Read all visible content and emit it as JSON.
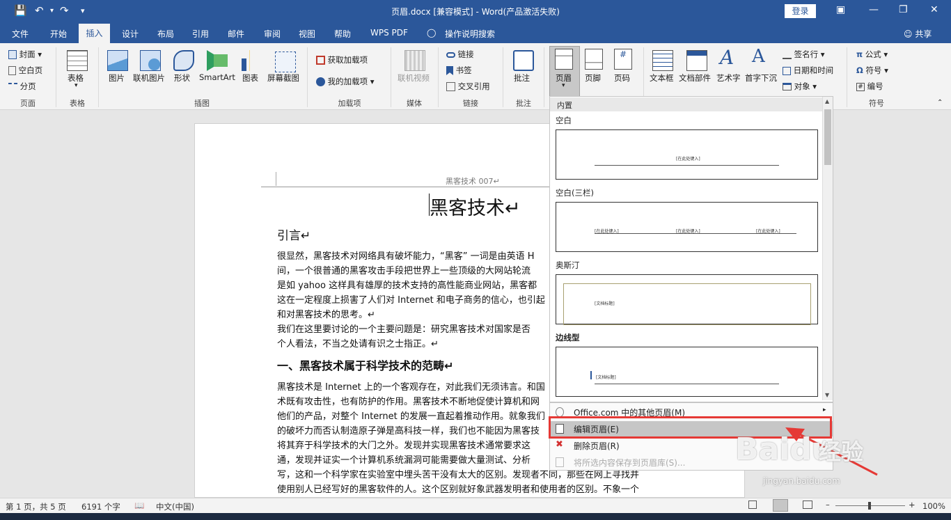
{
  "title_bar": {
    "document_title": "页眉.docx [兼容模式] - Word(产品激活失败)",
    "login": "登录"
  },
  "tabs": [
    "文件",
    "开始",
    "插入",
    "设计",
    "布局",
    "引用",
    "邮件",
    "审阅",
    "视图",
    "帮助",
    "WPS PDF",
    "操作说明搜索"
  ],
  "share": "共享",
  "ribbon": {
    "pages": {
      "items": [
        "封面",
        "空白页",
        "分页"
      ],
      "group": "页面"
    },
    "table": {
      "label": "表格",
      "group": "表格"
    },
    "illustrations": {
      "items": [
        "图片",
        "联机图片",
        "形状",
        "SmartArt",
        "图表",
        "屏幕截图"
      ],
      "group": "插图"
    },
    "addins": {
      "items": [
        "获取加载项",
        "我的加载项"
      ],
      "group": "加载项"
    },
    "media": {
      "label": "联机视频",
      "group": "媒体"
    },
    "links": {
      "items": [
        "链接",
        "书签",
        "交叉引用"
      ],
      "group": "链接"
    },
    "comments": {
      "label": "批注",
      "group": "批注"
    },
    "header_footer": {
      "items": [
        "页眉",
        "页脚",
        "页码"
      ]
    },
    "text": {
      "items": [
        "文本框",
        "文档部件",
        "艺术字",
        "首字下沉"
      ],
      "side": [
        "签名行",
        "日期和时间",
        "对象"
      ]
    },
    "symbols": {
      "items": [
        "公式",
        "符号",
        "编号"
      ],
      "group": "符号"
    }
  },
  "document": {
    "header": "黑客技术 007↵",
    "title": "黑客技术↵",
    "h_intro": "引言↵",
    "p1": [
      "很显然，黑客技术对网络具有破坏能力，“黑客” 一词是由英语 H",
      "间，一个很普通的黑客攻击手段把世界上一些顶级的大网站轮流",
      "是如 yahoo 这样具有雄厚的技术支持的高性能商业网站，黑客都",
      "这在一定程度上损害了人们对 Internet 和电子商务的信心，也引起",
      "和对黑客技术的思考。↵"
    ],
    "p2": [
      "我们在这里要讨论的一个主要问题是：研究黑客技术对国家是否",
      "个人看法，不当之处请有识之士指正。↵"
    ],
    "h1": "一、黑客技术属于科学技术的范畴↵",
    "p3": [
      "黑客技术是 Internet 上的一个客观存在，对此我们无须讳言。和国",
      "术既有攻击性，也有防护的作用。黑客技术不断地促使计算机和网",
      "他们的产品，对整个 Internet 的发展一直起着推动作用。就象我们",
      "的破坏力而否认制造原子弹是高科技一样，我们也不能因为黑客技",
      "将其弃于科学技术的大门之外。发现并实现黑客技术通常要求这",
      "通，发现并证实一个计算机系统漏洞可能需要做大量测试、分析",
      "写，这和一个科学家在实验室中埋头苦干没有太大的区别。发现者不同，那些在网上寻找并",
      "使用别人已经写好的黑客软件的人。这个区别就好象武器发明者和使用者的区别。不象一个"
    ]
  },
  "gallery": {
    "category": "内置",
    "items": [
      {
        "name": "空白",
        "texts": [
          "[在此处键入]"
        ]
      },
      {
        "name": "空白(三栏)",
        "texts": [
          "[在此处键入]",
          "[在此处键入]",
          "[在此处键入]"
        ]
      },
      {
        "name": "奥斯汀",
        "texts": [
          "[文档标题]"
        ]
      },
      {
        "name": "边线型",
        "texts": [
          "[文档标题]"
        ]
      }
    ]
  },
  "menu": {
    "more": "Office.com 中的其他页眉(M)",
    "edit": "编辑页眉(E)",
    "remove": "删除页眉(R)",
    "save": "将所选内容保存到页眉库(S)..."
  },
  "status": {
    "page": "第 1 页，共 5 页",
    "words": "6191 个字",
    "lang": "中文(中国)",
    "zoom": "100%"
  },
  "watermark": {
    "brand": "Baidu",
    "sub": "jingyan.baidu.com",
    "cn": "经验"
  },
  "colors": {
    "accent": "#2b579a",
    "highlight": "#e53935"
  }
}
